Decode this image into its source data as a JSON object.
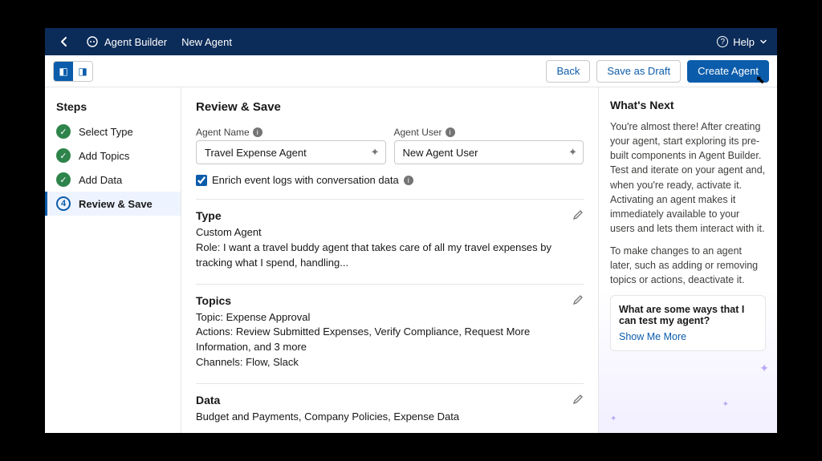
{
  "topbar": {
    "app_name": "Agent Builder",
    "breadcrumb": "New Agent",
    "help_label": "Help"
  },
  "toolbar": {
    "back_label": "Back",
    "draft_label": "Save as Draft",
    "create_label": "Create Agent"
  },
  "steps": {
    "heading": "Steps",
    "items": [
      {
        "label": "Select Type",
        "done": true
      },
      {
        "label": "Add Topics",
        "done": true
      },
      {
        "label": "Add Data",
        "done": true
      },
      {
        "label": "Review & Save",
        "current": true,
        "number": "4"
      }
    ]
  },
  "main": {
    "title": "Review & Save",
    "agent_name_label": "Agent Name",
    "agent_name_value": "Travel Expense Agent",
    "agent_user_label": "Agent User",
    "agent_user_value": "New Agent User",
    "enrich_label": "Enrich event logs with conversation data",
    "type": {
      "heading": "Type",
      "value": "Custom Agent",
      "role": "Role: I want a travel buddy agent that takes care of all my travel expenses by tracking what I spend, handling..."
    },
    "topics": {
      "heading": "Topics",
      "topic": "Topic: Expense Approval",
      "actions": "Actions: Review Submitted Expenses, Verify Compliance, Request More Information, and 3 more",
      "channels": "Channels: Flow, Slack"
    },
    "data": {
      "heading": "Data",
      "value": "Budget and Payments, Company Policies, Expense Data"
    }
  },
  "right": {
    "heading": "What's Next",
    "p1": "You're almost there! After creating your agent, start exploring its pre-built components in Agent Builder. Test and iterate on your agent and, when you're ready, activate it. Activating an agent makes it immediately available to your users and lets them interact with it.",
    "p2": "To make changes to an agent later, such as adding or removing topics or actions, deactivate it.",
    "card_question": "What are some ways that I can test my agent?",
    "card_link": "Show Me More"
  }
}
